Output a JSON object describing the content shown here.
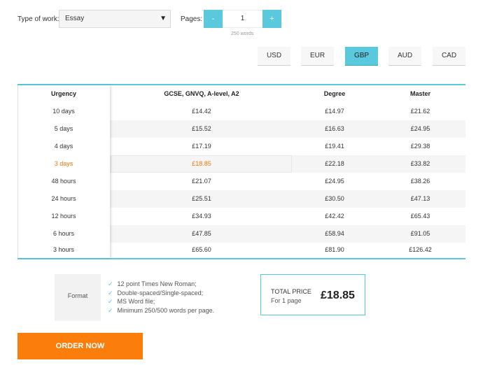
{
  "form": {
    "type_label": "Type of work:",
    "type_value": "Essay",
    "select_arrow": "▼",
    "pages_label": "Pages:",
    "minus": "-",
    "plus": "+",
    "pages_value": "1",
    "words": "250 words"
  },
  "currencies": [
    {
      "label": "USD",
      "active": false
    },
    {
      "label": "EUR",
      "active": false
    },
    {
      "label": "GBP",
      "active": true
    },
    {
      "label": "AUD",
      "active": false
    },
    {
      "label": "CAD",
      "active": false
    }
  ],
  "table": {
    "headers": [
      "Urgency",
      "GCSE, GNVQ, A-level, A2",
      "Degree",
      "Master"
    ],
    "rows": [
      [
        "10 days",
        "£14.42",
        "£14.97",
        "£21.62"
      ],
      [
        "5 days",
        "£15.52",
        "£16.63",
        "£24.95"
      ],
      [
        "4 days",
        "£17.19",
        "£19.41",
        "£29.38"
      ],
      [
        "3 days",
        "£18.85",
        "£22.18",
        "£33.82"
      ],
      [
        "48 hours",
        "£21.07",
        "£24.95",
        "£38.26"
      ],
      [
        "24 hours",
        "£25.51",
        "£30.50",
        "£47.13"
      ],
      [
        "12 hours",
        "£34.93",
        "£42.42",
        "£65.43"
      ],
      [
        "6 hours",
        "£47.85",
        "£58.94",
        "£91.05"
      ],
      [
        "3 hours",
        "£65.60",
        "£81.90",
        "£126.42"
      ]
    ],
    "selected_row_index": 3
  },
  "format": {
    "label": "Format",
    "items": [
      "12 point Times New Roman;",
      "Double-spaced/Single-spaced;",
      "MS Word file;",
      "Minimum 250/500 words per page."
    ],
    "check_icon": "check-icon"
  },
  "price": {
    "label": "TOTAL PRICE",
    "sub": "For 1 page",
    "value": "£18.85"
  },
  "order_button": "ORDER NOW",
  "colors": {
    "accent": "#5ac8dd",
    "order": "#fb7e0c",
    "selected_text": "#f2760c"
  }
}
